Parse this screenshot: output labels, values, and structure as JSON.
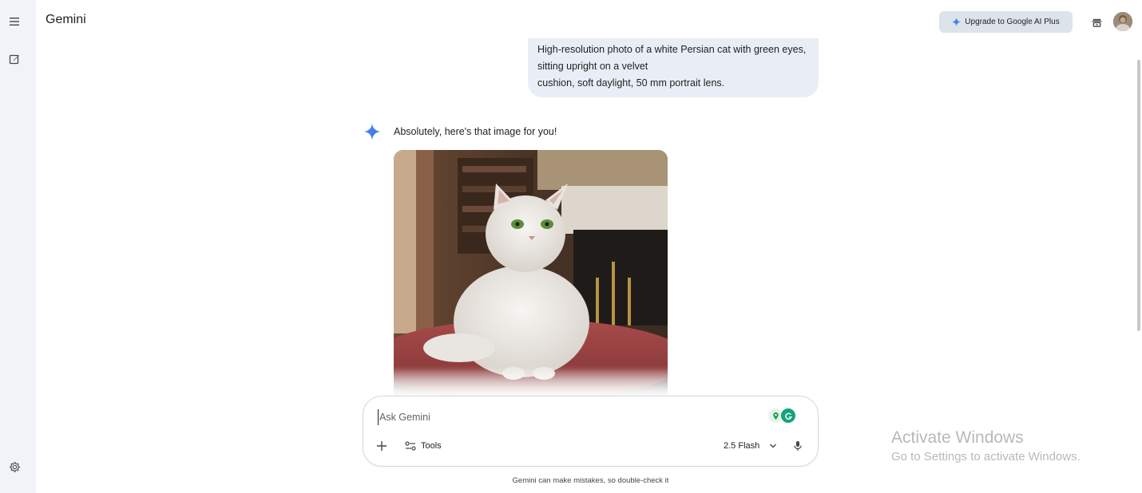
{
  "app": {
    "name": "Gemini"
  },
  "header": {
    "upgrade_label": "Upgrade to Google AI Plus"
  },
  "conversation": {
    "user_prompt_lines": [
      "High-resolution photo of a white Persian cat with green eyes,",
      "sitting upright on a velvet",
      "cushion, soft daylight, 50 mm portrait lens."
    ],
    "model_reply": "Absolutely, here's that image for you!"
  },
  "composer": {
    "placeholder": "Ask Gemini",
    "tools_label": "Tools",
    "model_label": "2.5 Flash"
  },
  "footer": {
    "disclaimer": "Gemini can make mistakes, so double-check it"
  },
  "watermark": {
    "title": "Activate Windows",
    "subtitle": "Go to Settings to activate Windows."
  },
  "icons": {
    "rail": [
      "menu-icon",
      "new-chat-icon",
      "settings-icon"
    ],
    "top": [
      "sparkle-icon",
      "incognito-icon",
      "avatar"
    ],
    "composer": [
      "add-icon",
      "tools-icon",
      "chevron-down-icon",
      "mic-icon"
    ]
  },
  "colors": {
    "accent_blue": "#4285f4",
    "rail_bg": "#f0f4f9",
    "bubble_bg": "#e9eef6",
    "upgrade_bg": "#dde3ea"
  }
}
